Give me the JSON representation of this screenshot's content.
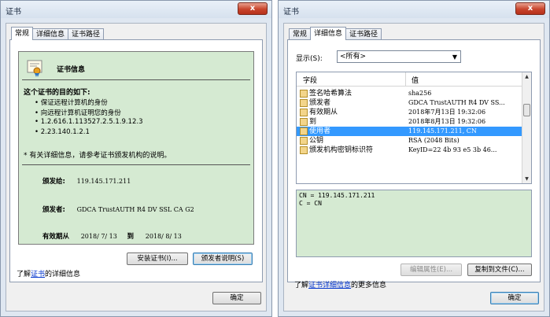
{
  "left_window": {
    "title": "证书",
    "close_label": "x",
    "tabs": [
      "常规",
      "详细信息",
      "证书路径"
    ],
    "cert_info_title": "证书信息",
    "purpose_heading": "这个证书的目的如下:",
    "purposes": [
      "• 保证远程计算机的身份",
      "• 向远程计算机证明您的身份",
      "• 1.2.616.1.113527.2.5.1.9.12.3",
      "• 2.23.140.1.2.1"
    ],
    "note": "* 有关详细信息，请参考证书颁发机构的说明。",
    "issued_to_label": "颁发给:",
    "issued_to_value": "119.145.171.211",
    "issued_by_label": "颁发者:",
    "issued_by_value": "GDCA TrustAUTH R4 DV SSL CA G2",
    "validity_label": "有效期从",
    "validity_from": "2018/ 7/ 13",
    "validity_to_label": "到",
    "validity_to": "2018/ 8/ 13",
    "install_button": "安装证书(I)...",
    "issuer_stmt_button": "颁发者说明(S)",
    "learn_prefix": "了解",
    "learn_link": "证书",
    "learn_suffix": "的详细信息",
    "ok_button": "确定"
  },
  "right_window": {
    "title": "证书",
    "close_label": "x",
    "tabs": [
      "常规",
      "详细信息",
      "证书路径"
    ],
    "show_label": "显示(S):",
    "show_value": "<所有>",
    "col_field": "字段",
    "col_value": "值",
    "rows": [
      {
        "field": "签名哈希算法",
        "value": "sha256"
      },
      {
        "field": "颁发者",
        "value": "GDCA TrustAUTH R4 DV SS..."
      },
      {
        "field": "有效期从",
        "value": "2018年7月13日 19:32:06"
      },
      {
        "field": "到",
        "value": "2018年8月13日 19:32:06"
      },
      {
        "field": "使用者",
        "value": "119.145.171.211, CN"
      },
      {
        "field": "公钥",
        "value": "RSA (2048 Bits)"
      },
      {
        "field": "颁发机构密钥标识符",
        "value": "KeyID=22 4b 93 e5 3b 46..."
      }
    ],
    "selected_index": 4,
    "detail_lines": [
      "CN = 119.145.171.211",
      "C = CN"
    ],
    "edit_props_button": "编辑属性(E)...",
    "copy_file_button": "复制到文件(C)...",
    "learn_prefix": "了解",
    "learn_link": "证书详细信息",
    "learn_suffix": "的更多信息",
    "ok_button": "确定"
  }
}
